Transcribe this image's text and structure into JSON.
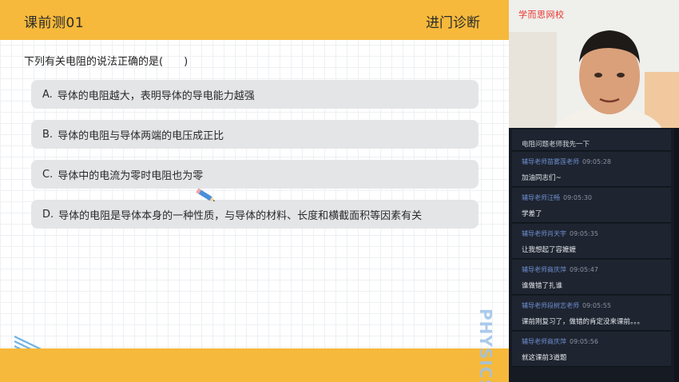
{
  "slide": {
    "title": "课前测01",
    "tag": "进门诊断",
    "question": "下列有关电阻的说法正确的是(　　)",
    "options": [
      {
        "letter": "A.",
        "text": "导体的电阻越大，表明导体的导电能力越强"
      },
      {
        "letter": "B.",
        "text": "导体的电阻与导体两端的电压成正比"
      },
      {
        "letter": "C.",
        "text": "导体中的电流为零时电阻也为零"
      },
      {
        "letter": "D.",
        "text": "导体的电阻是导体本身的一种性质，与导体的材料、长度和横截面积等因素有关"
      }
    ],
    "watermark": "PHYSICS",
    "colors": {
      "accent": "#f6b93b",
      "option_bg": "#e4e5e7"
    }
  },
  "video": {
    "brand": "学而思网校"
  },
  "chat": {
    "partial_top": "电阻问题老师我先一下",
    "messages": [
      {
        "name": "辅导老师苗雾莲老师",
        "time": "09:05:28",
        "text": "加油同志们~"
      },
      {
        "name": "辅导老师汪畅",
        "time": "09:05:30",
        "text": "学差了"
      },
      {
        "name": "辅导老师肖天宇",
        "time": "09:05:35",
        "text": "让我想起了容嬷嬷"
      },
      {
        "name": "辅导老师商庆萍",
        "time": "09:05:47",
        "text": "谁做错了扎谁"
      },
      {
        "name": "辅导老师段树志老师",
        "time": "09:05:55",
        "text": "课前刚复习了，做错的肯定没来课前。。。"
      },
      {
        "name": "辅导老师商庆萍",
        "time": "09:05:56",
        "text": "就这课前3道题"
      }
    ],
    "colors": {
      "panel_bg": "#161a22",
      "bubble_bg": "#1e2430",
      "name": "#6f8fd1"
    }
  }
}
